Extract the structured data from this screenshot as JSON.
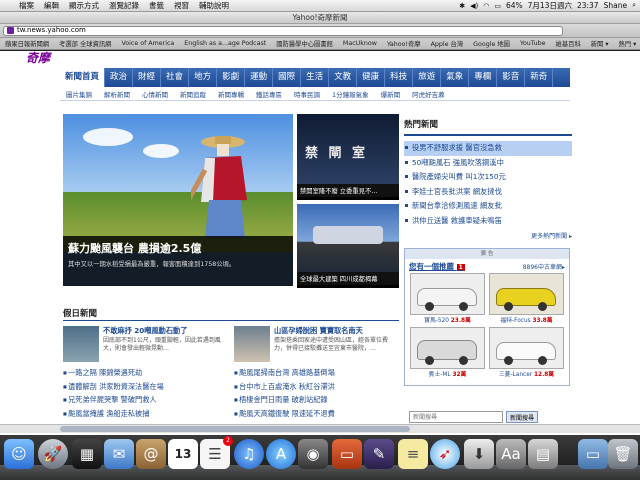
{
  "menubar": {
    "items": [
      "檔案",
      "編輯",
      "顯示方式",
      "瀏覽記錄",
      "書籤",
      "視窗",
      "輔助說明"
    ],
    "battery": "64%",
    "date": "7月13日週六",
    "time": "23:37",
    "user": "Shane"
  },
  "window": {
    "title": "Yahoo!奇摩新聞"
  },
  "address": {
    "url": "tw.news.yahoo.com"
  },
  "bookmarks": [
    "蘋果日報新聞網",
    "考選部 全球資訊網",
    "Voice of America",
    "English as a...age Podcast",
    "國防醫學中心圖書館",
    "MacUknow",
    "Yahoo!奇摩",
    "Apple 台灣",
    "Google 地圖",
    "YouTube",
    "維基百科",
    "新聞 ▾",
    "熱門 ▾"
  ],
  "logo": {
    "text": "奇摩"
  },
  "nav": [
    "新聞首頁",
    "政治",
    "財經",
    "社會",
    "地方",
    "影劇",
    "運動",
    "國際",
    "生活",
    "文教",
    "健康",
    "科技",
    "旅遊",
    "氣象",
    "專欄",
    "影音",
    "新奇"
  ],
  "subnav": [
    "圖片集錦",
    "解析新聞",
    "心情新聞",
    "新聞追蹤",
    "新聞專輯",
    "鐵話專區",
    "時事民調",
    "1分鐘報氣象",
    "爆新聞",
    "阿虎好吉蔴"
  ],
  "hero": {
    "headline": "蘇力颱風襲台 農損逾2.5億",
    "summary": "其中又以一期水稻受損最為嚴重，報害面積達到1758公頃。"
  },
  "thumbs": [
    {
      "caption": "禁開室隆不廢 立委重見不…",
      "sign": "禁 閘 室"
    },
    {
      "caption": "全球最大建築 四川成都揭幕"
    }
  ],
  "hot": {
    "title": "熱門新聞",
    "items": [
      "役男不舒服求援 醫官沒急救",
      "50噸颱風石 強風吹落鋼溪中",
      "醫院產婦尖叫費 叫1次150元",
      "李娃士官長批洪案 網友撻伐",
      "新聞台拿洽修測風速 網友批",
      "洪仲丘送醫 救護車疑未鳴笛"
    ],
    "more": "更多熱門新聞 ▸"
  },
  "ad": {
    "label": "廣 告",
    "left_link": "您有一個推薦",
    "badge": "1",
    "right_link": "8896中古車網▸",
    "cars": [
      {
        "name": "寶馬-520",
        "price": "23.8萬"
      },
      {
        "name": "福特-Focus",
        "price": "33.8萬"
      },
      {
        "name": "賓士-ML",
        "price": "32萬"
      },
      {
        "name": "三菱-Lancer",
        "price": "12.8萬"
      }
    ]
  },
  "holiday": {
    "title": "假日新聞",
    "stories": [
      {
        "title": "不敢麻抒 20噸風動石動了",
        "desc": "因底部不到1公尺，頭重腳輕，因此若遇到風大，則會發出輕微晃動…"
      },
      {
        "title": "山區孕婦脫困 寶寶取名南天",
        "desc": "擔架搭乘回家途中遭受困山區，經各單位費力，併得已接駁攤送至宜東市醫院，…"
      }
    ],
    "left_list": [
      "一路之隔 陳錦榮遇死劫",
      "遺體解剖 洪家盼資深法醫在場",
      "兄死弟伴屍哭撃 警破門救人",
      "颱風當掩護 漁船走私被捕"
    ],
    "right_list": [
      "颱風尾掃南台灣 高雄路基倒塌",
      "台中市上百處淹水 秋紅谷滯洪",
      "梧棲金門日雨量 破創站紀錄",
      "颱風天高鐵復駛 限速延不退費"
    ]
  },
  "search": {
    "placeholder": "新聞搜尋",
    "button": "新聞搜尋"
  },
  "colors": {
    "nav_blue": "#1d4a93",
    "link_blue": "#1d4a93",
    "price_red": "#cc0000"
  },
  "dock": [
    "finder-icon",
    "launchpad-icon",
    "mission-control-icon",
    "mail-icon",
    "address-book-icon",
    "calendar-icon",
    "reminders-icon",
    "itunes-icon",
    "app-store-icon",
    "photo-booth-icon",
    "keynote-icon",
    "safari-icon",
    "preview-icon",
    "textedit-icon",
    "trash-icon"
  ],
  "dock_calendar": {
    "day": "13",
    "badge": "2"
  }
}
